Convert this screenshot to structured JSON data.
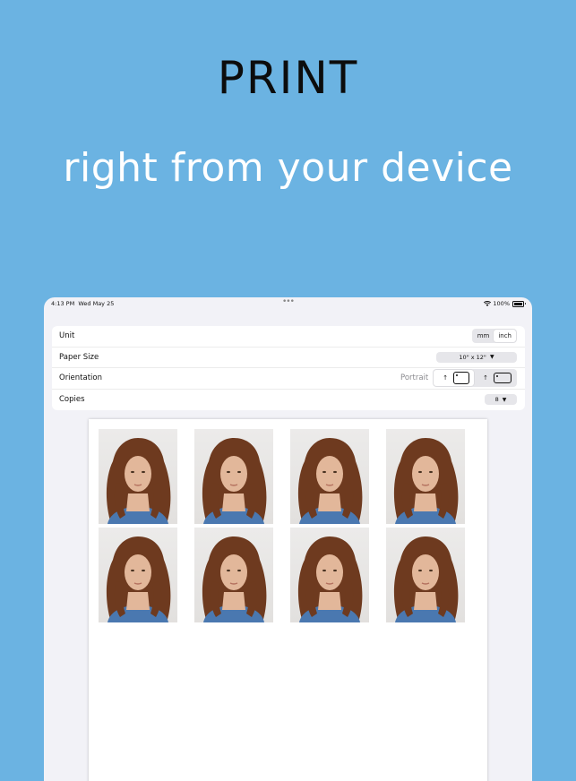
{
  "marketing": {
    "headline": "PRINT",
    "subheadline": "right from your device"
  },
  "status_bar": {
    "time": "4:13 PM",
    "date": "Wed May 25",
    "battery": "100%"
  },
  "settings": {
    "unit": {
      "label": "Unit",
      "options": [
        "mm",
        "inch"
      ],
      "selected": "inch"
    },
    "paper_size": {
      "label": "Paper Size",
      "value": "10\" x 12\""
    },
    "orientation": {
      "label": "Orientation",
      "value": "Portrait"
    },
    "copies": {
      "label": "Copies",
      "value": "8"
    }
  },
  "preview": {
    "photo_count": 8
  },
  "colors": {
    "background": "#6bb3e2",
    "device_bg": "#f2f2f7",
    "hair": "#6e3a1f",
    "skin": "#e2b79a"
  }
}
